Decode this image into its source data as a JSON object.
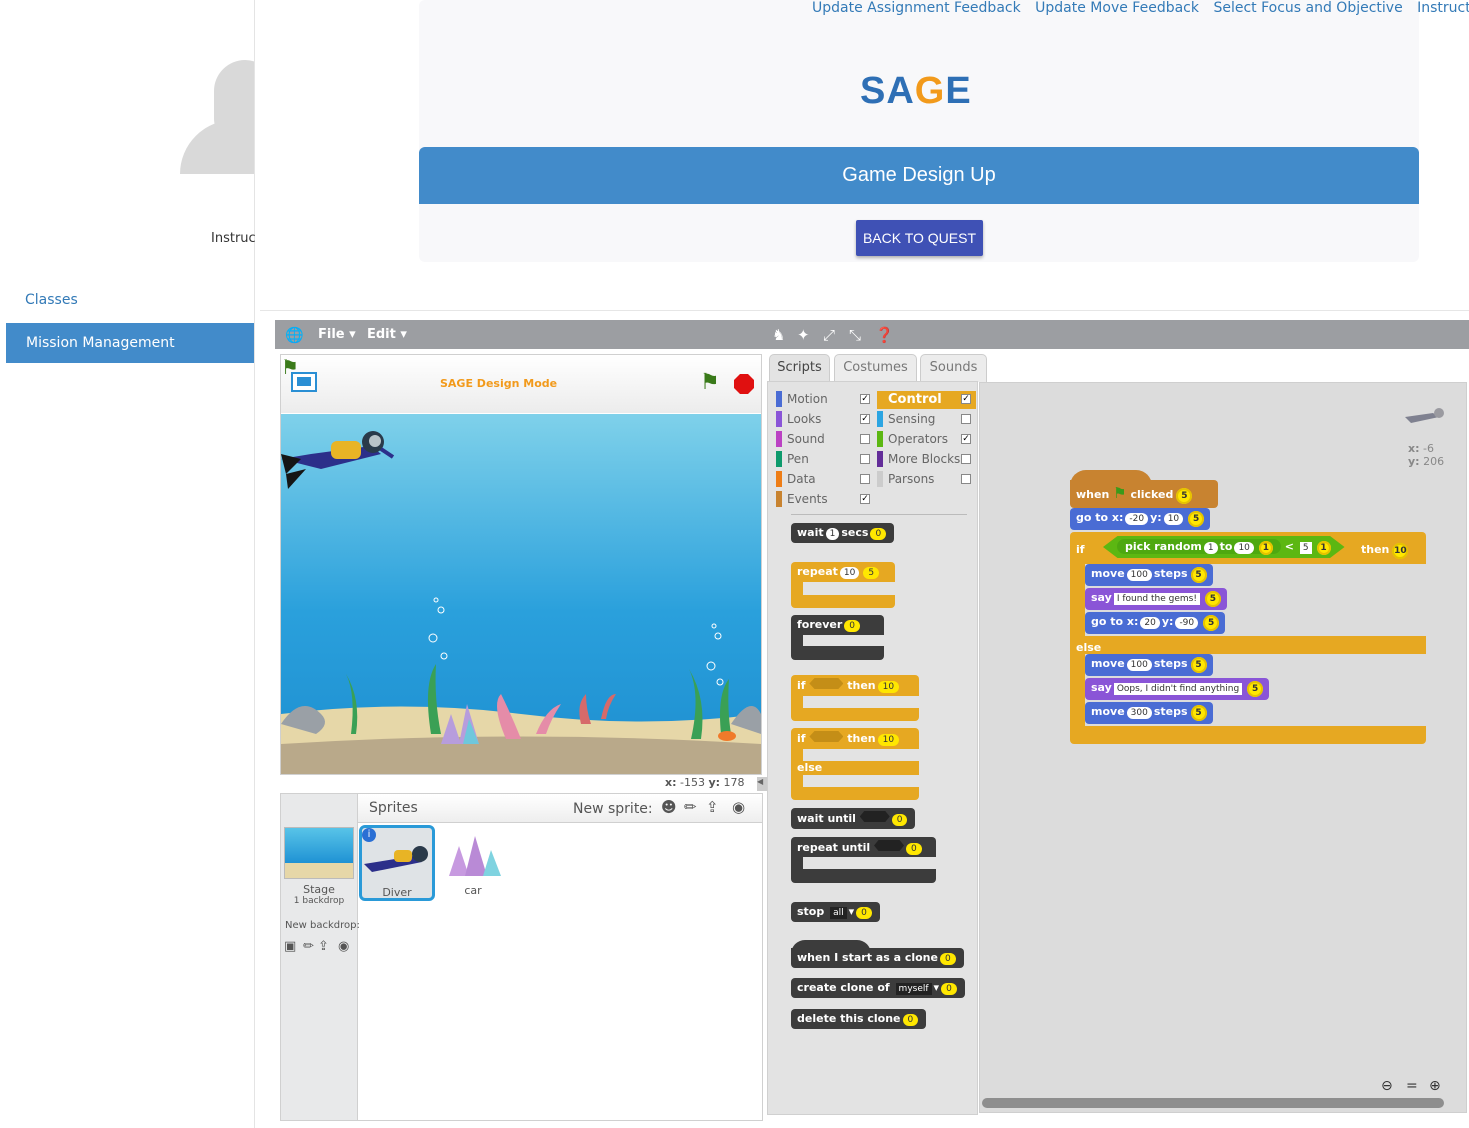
{
  "top_links": [
    "Update Assignment Feedback",
    "Update Move Feedback",
    "Select Focus and Objective",
    "Instruction"
  ],
  "sidebar": {
    "instructor_label": "Instructor",
    "items": [
      {
        "label": "Classes",
        "active": false
      },
      {
        "label": "Mission Management",
        "active": true
      }
    ]
  },
  "logo": {
    "text_a": "SA",
    "text_g": "G",
    "text_b": "E"
  },
  "quest": {
    "title": "Game Design Up",
    "back_button": "BACK TO QUEST"
  },
  "scratch": {
    "menu": {
      "file": "File",
      "edit": "Edit"
    },
    "stage_title": "SAGE Design Mode",
    "mouse": {
      "x_label": "x:",
      "x": "-153",
      "y_label": "y:",
      "y": "178"
    },
    "sprites_label": "Sprites",
    "new_sprite_label": "New sprite:",
    "stage_item": {
      "name": "Stage",
      "sub": "1 backdrop",
      "new_backdrop": "New backdrop:"
    },
    "sprites": [
      {
        "name": "Diver",
        "selected": true
      },
      {
        "name": "car",
        "selected": false
      }
    ],
    "tabs": [
      "Scripts",
      "Costumes",
      "Sounds"
    ],
    "categories": [
      {
        "name": "Motion",
        "color": "#4a6cd4",
        "checked": true
      },
      {
        "name": "Looks",
        "color": "#8a55d7",
        "checked": true
      },
      {
        "name": "Sound",
        "color": "#bb42c3",
        "checked": false
      },
      {
        "name": "Pen",
        "color": "#0e9a6c",
        "checked": false
      },
      {
        "name": "Data",
        "color": "#ee7d16",
        "checked": false
      },
      {
        "name": "Events",
        "color": "#c88330",
        "checked": true
      },
      {
        "name": "Control",
        "color": "#e6a822",
        "checked": true
      },
      {
        "name": "Sensing",
        "color": "#2ca5e2",
        "checked": false
      },
      {
        "name": "Operators",
        "color": "#5cb712",
        "checked": true
      },
      {
        "name": "More Blocks",
        "color": "#632d99",
        "checked": false
      },
      {
        "name": "Parsons",
        "color": "#cccccc",
        "checked": false
      }
    ],
    "palette_blocks": {
      "wait": {
        "a": "wait",
        "n": "1",
        "b": "secs",
        "p": "0"
      },
      "repeat": {
        "a": "repeat",
        "n": "10",
        "p": "5"
      },
      "forever": {
        "a": "forever",
        "p": "0"
      },
      "if1": {
        "a": "if",
        "b": "then",
        "p": "10"
      },
      "if2": {
        "a": "if",
        "b": "then",
        "p": "10",
        "c": "else"
      },
      "wait_until": {
        "a": "wait until",
        "p": "0"
      },
      "repeat_until": {
        "a": "repeat until",
        "p": "0"
      },
      "stop": {
        "a": "stop",
        "opt": "all",
        "p": "0"
      },
      "clone_start": {
        "a": "when I start as a clone",
        "p": "0"
      },
      "create_clone": {
        "a": "create clone of",
        "opt": "myself",
        "p": "0"
      },
      "delete_clone": {
        "a": "delete this clone",
        "p": "0"
      }
    },
    "sprite_pos": {
      "x_label": "x:",
      "x": "-6",
      "y_label": "y:",
      "y": "206"
    },
    "script": {
      "hat": {
        "a": "when",
        "b": "clicked",
        "p": "5"
      },
      "goto1": {
        "a": "go to x:",
        "x": "-20",
        "b": "y:",
        "y": "10",
        "p": "5"
      },
      "if": {
        "a": "if",
        "op": "pick random",
        "n1": "1",
        "to": "to",
        "n2": "10",
        "p1": "1",
        "lt": "<",
        "v": "5",
        "p2": "1",
        "then": "then",
        "p": "10"
      },
      "move1": {
        "a": "move",
        "n": "100",
        "b": "steps",
        "p": "5"
      },
      "say1": {
        "a": "say",
        "t": "I found the gems!",
        "p": "5"
      },
      "goto2": {
        "a": "go to x:",
        "x": "20",
        "b": "y:",
        "y": "-90",
        "p": "5"
      },
      "else": "else",
      "move2": {
        "a": "move",
        "n": "100",
        "b": "steps",
        "p": "5"
      },
      "say2": {
        "a": "say",
        "t": "Oops, I didn't find anything",
        "p": "5"
      },
      "move3": {
        "a": "move",
        "n": "300",
        "b": "steps",
        "p": "5"
      }
    }
  }
}
